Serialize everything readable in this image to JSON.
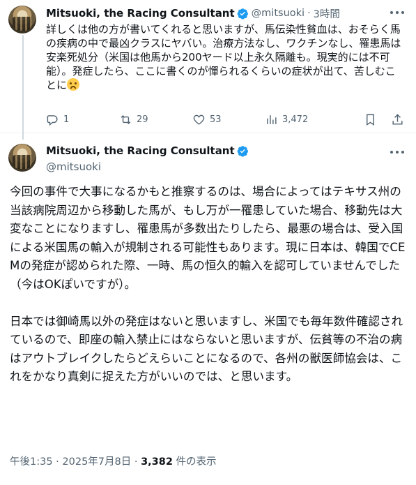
{
  "colors": {
    "accent": "#1d9bf0",
    "muted": "#536471",
    "text": "#0f1419",
    "line": "#cfd9de"
  },
  "tweet1": {
    "name": "Mitsuoki, the Racing Consultant",
    "handle": "@mitsuoki",
    "separator": "·",
    "time": "3時間",
    "text": "詳しくは他の方が書いてくれると思いますが、馬伝染性貧血は、おそらく馬の疾病の中で最凶クラスにヤバい。治療方法なし、ワクチンなし、罹患馬は安楽死処分（米国は他馬から200ヤード以上永久隔離も。現実的には不可能）。発症したら、ここに書くのが憚られるくらいの症状が出て、苦しむことに",
    "emoji": "loudly-crying-face",
    "stats": {
      "replies": "1",
      "retweets": "29",
      "likes": "53",
      "views": "3,472"
    }
  },
  "tweet2": {
    "name": "Mitsuoki, the Racing Consultant",
    "handle": "@mitsuoki",
    "paragraphs": [
      "今回の事件で大事になるかもと推察するのは、場合によってはテキサス州の当該病院周辺から移動した馬が、もし万が一罹患していた場合、移動先は大変なことになりますし、罹患馬が多数出たりしたら、最悪の場合は、受入国による米国馬の輸入が規制される可能性もあります。現に日本は、韓国でCEMの発症が認められた際、一時、馬の恒久的輸入を認可していませんでした（今はOKぽいですが）。",
      "日本では御崎馬以外の発症はないと思いますし、米国でも毎年数件確認されているので、即座の輸入禁止にはならないと思いますが、伝貧等の不治の病はアウトブレイクしたらどえらいことになるので、各州の獣医師協会は、これをかなり真剣に捉えた方がいいのでは、と思います。"
    ],
    "timestamp": "午後1:35 · 2025年7月8日 · ",
    "views_count": "3,382",
    "views_label": " 件の表示"
  }
}
